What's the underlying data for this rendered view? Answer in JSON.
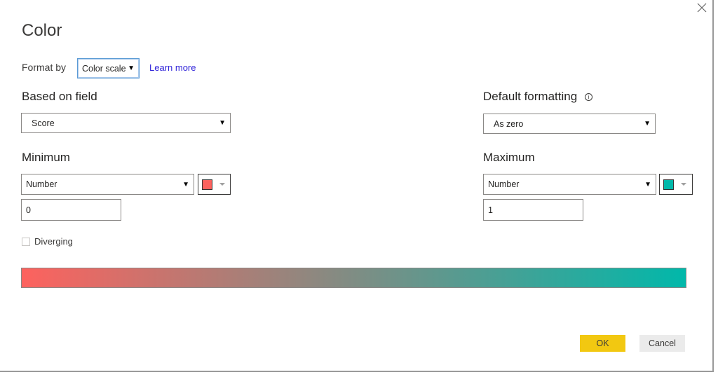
{
  "dialog": {
    "title": "Color",
    "close_icon": "close-icon"
  },
  "format_by": {
    "label": "Format by",
    "selected": "Color scale",
    "learn_more": "Learn more"
  },
  "based_on_field": {
    "label": "Based on field",
    "selected": "Score"
  },
  "default_formatting": {
    "label": "Default formatting",
    "info_icon": "info-icon",
    "selected": "As zero"
  },
  "minimum": {
    "label": "Minimum",
    "type": "Number",
    "value": "0",
    "color": "#fd625e"
  },
  "maximum": {
    "label": "Maximum",
    "type": "Number",
    "value": "1",
    "color": "#01b8aa"
  },
  "diverging": {
    "label": "Diverging",
    "checked": false
  },
  "gradient": {
    "start_color": "#fd625e",
    "end_color": "#01b8aa"
  },
  "buttons": {
    "ok": "OK",
    "cancel": "Cancel",
    "ok_color": "#f2c811"
  }
}
